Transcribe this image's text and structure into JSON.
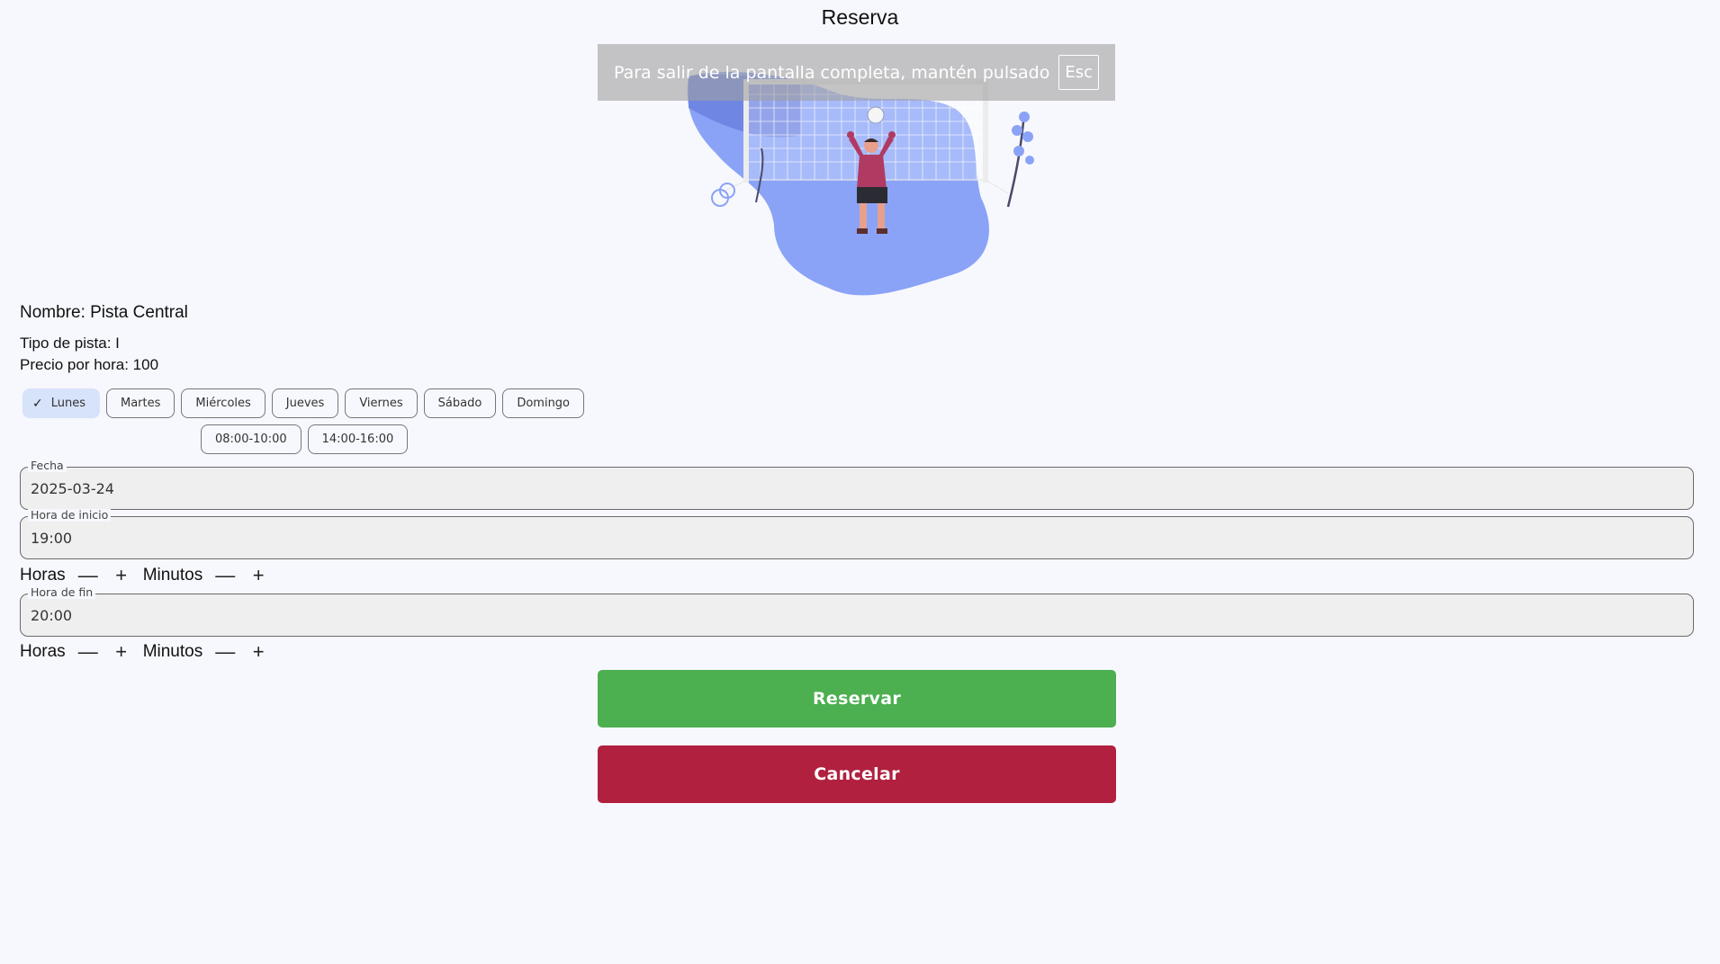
{
  "page": {
    "title": "Reserva"
  },
  "fullscreen_toast": {
    "message": "Para salir de la pantalla completa, mantén pulsado",
    "key": "Esc"
  },
  "court": {
    "name": "Nombre: Pista Central",
    "type": "Tipo de pista: I",
    "price": "Precio por hora: 100"
  },
  "days": [
    {
      "label": "Lunes",
      "selected": true
    },
    {
      "label": "Martes",
      "selected": false
    },
    {
      "label": "Miércoles",
      "selected": false
    },
    {
      "label": "Jueves",
      "selected": false
    },
    {
      "label": "Viernes",
      "selected": false
    },
    {
      "label": "Sábado",
      "selected": false
    },
    {
      "label": "Domingo",
      "selected": false
    }
  ],
  "slots": [
    "08:00-10:00",
    "14:00-16:00"
  ],
  "fields": {
    "fecha": {
      "label": "Fecha",
      "value": "2025-03-24"
    },
    "hora_inicio": {
      "label": "Hora de inicio",
      "value": "19:00"
    },
    "hora_fin": {
      "label": "Hora de fin",
      "value": "20:00"
    }
  },
  "stepper": {
    "hours_label": "Horas",
    "minutes_label": "Minutos",
    "minus": "—",
    "plus": "+"
  },
  "buttons": {
    "reservar": "Reservar",
    "cancelar": "Cancelar"
  },
  "colors": {
    "reservar": "#4caf50",
    "cancelar": "#b1203f",
    "selected_chip": "#d7e2fb",
    "illustration_blue": "#7f9cf5"
  },
  "illustration": {
    "subject": "goalkeeper-in-goal-illustration"
  }
}
